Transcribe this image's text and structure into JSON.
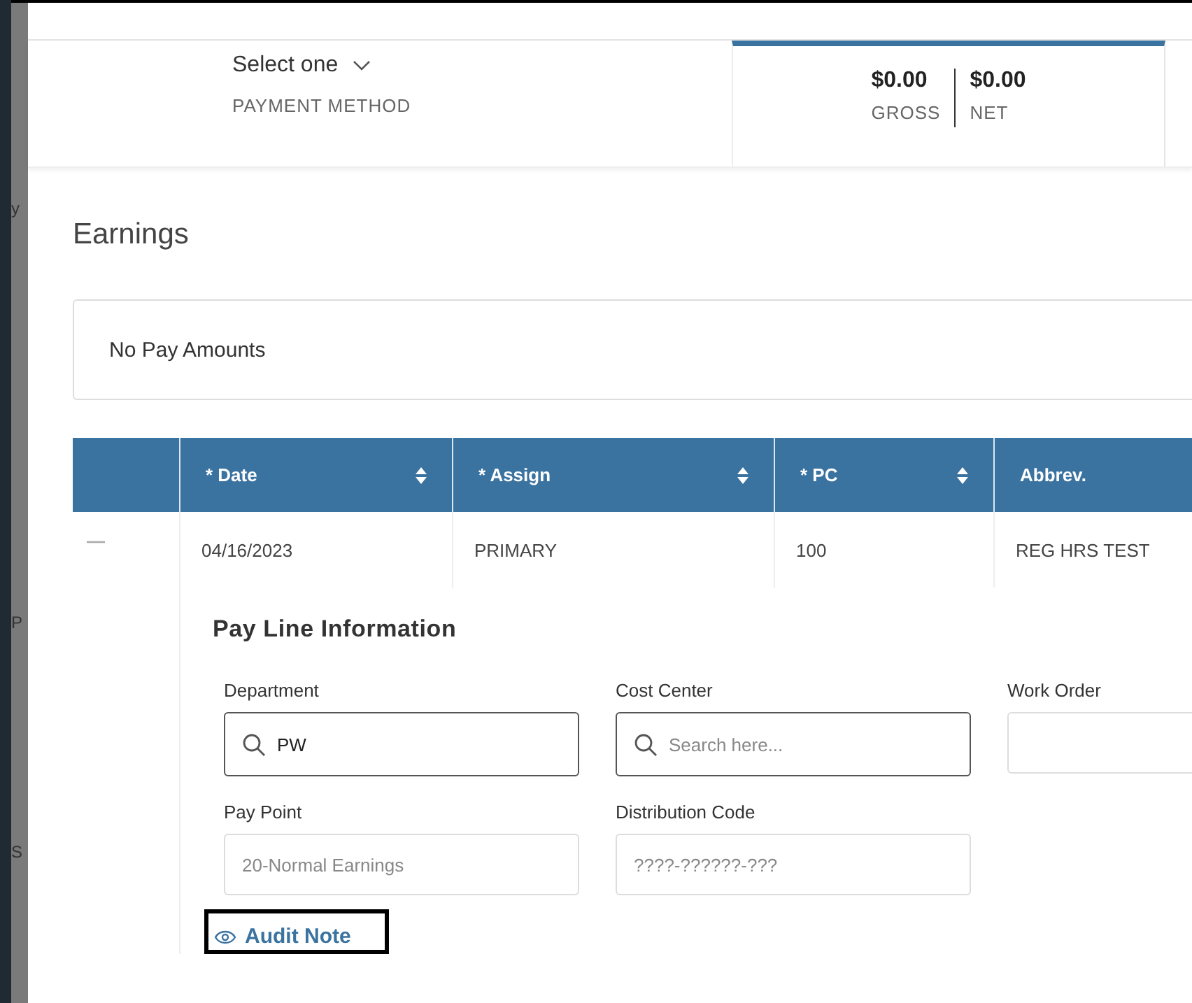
{
  "background_fragments": [
    "y",
    "P",
    "S"
  ],
  "payment": {
    "value": "Select one",
    "label": "PAYMENT METHOD"
  },
  "totals": [
    {
      "amount": "$0.00",
      "label": "GROSS"
    },
    {
      "amount": "$0.00",
      "label": "NET"
    }
  ],
  "section_title": "Earnings",
  "pay_amounts": "No Pay Amounts",
  "table": {
    "columns": [
      {
        "label": "* Date",
        "sortable": true
      },
      {
        "label": "* Assign",
        "sortable": true
      },
      {
        "label": "* PC",
        "sortable": true
      },
      {
        "label": "Abbrev.",
        "sortable": false
      }
    ],
    "rows": [
      {
        "expanded": true,
        "cells": [
          "04/16/2023",
          "PRIMARY",
          "100",
          "REG HRS TEST"
        ],
        "detail": {
          "title": "Pay Line Information",
          "field_rows": [
            [
              {
                "label": "Department",
                "kind": "search",
                "value": "PW",
                "disabled": false
              },
              {
                "label": "Cost Center",
                "kind": "search",
                "placeholder": "Search here...",
                "disabled": false
              },
              {
                "label": "Work Order",
                "kind": "text",
                "disabled": true
              }
            ],
            [
              {
                "label": "Pay Point",
                "kind": "text",
                "placeholder": "20-Normal Earnings",
                "disabled": true
              },
              {
                "label": "Distribution Code",
                "kind": "text",
                "placeholder": "????-??????-???",
                "disabled": true
              }
            ]
          ],
          "link": "Audit Note"
        }
      }
    ]
  }
}
